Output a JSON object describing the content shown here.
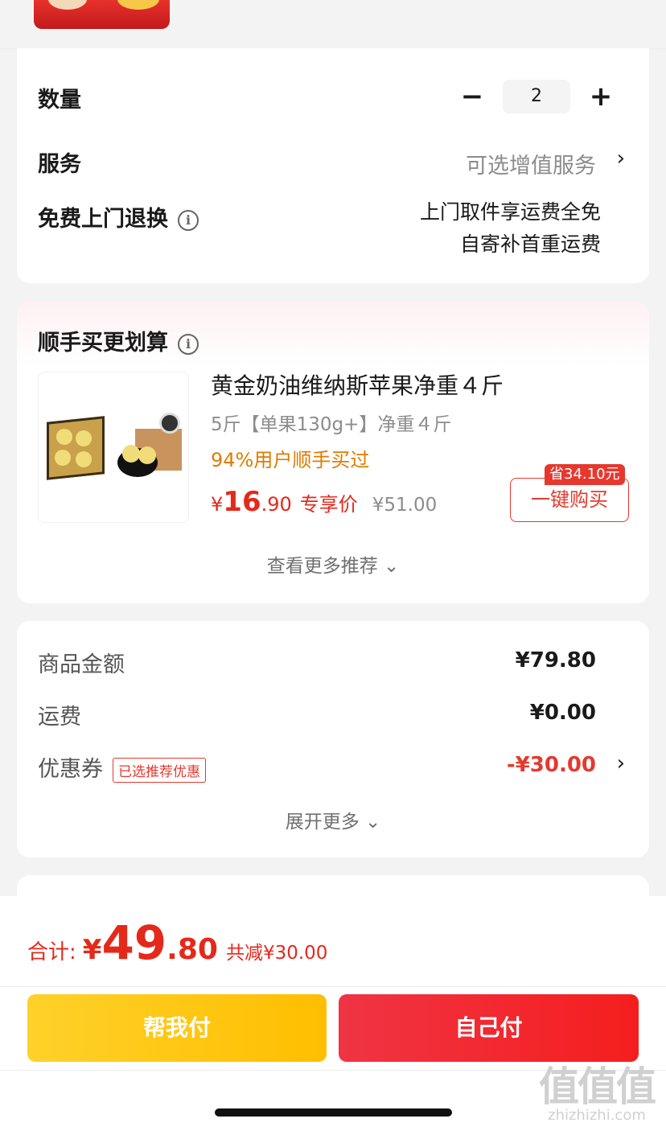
{
  "quantity": {
    "label": "数量",
    "minus": "−",
    "value": "2",
    "plus": "+"
  },
  "service": {
    "label": "服务",
    "value": "可选增值服务",
    "chevron": "›"
  },
  "return_policy": {
    "label": "免费上门退换",
    "info_icon": "i",
    "line1": "上门取件享运费全免",
    "line2": "自寄补首重运费"
  },
  "bundle": {
    "title": "顺手买更划算",
    "info_icon": "i",
    "product": {
      "title": "黄金奶油维纳斯苹果净重４斤",
      "spec": "5斤【单果130g+】净重４斤",
      "stat": "94%用户顺手买过",
      "price_yen": "¥",
      "price_int": "16",
      "price_dec": ".90",
      "price_tag": "专享价",
      "orig_price": "¥51.00",
      "save_badge": "省34.10元",
      "buy_button": "一键购买"
    },
    "more": "查看更多推荐 ⌄"
  },
  "amounts": {
    "goods_label": "商品金额",
    "goods_value": "¥79.80",
    "shipping_label": "运费",
    "shipping_value": "¥0.00",
    "coupon_label": "优惠券",
    "coupon_tag": "已选推荐优惠",
    "coupon_value": "-¥30.00",
    "chevron": "›",
    "expand": "展开更多 ⌄"
  },
  "footer": {
    "total_label": "合计:",
    "total_yen": "¥",
    "total_int": "49",
    "total_dec": ".80",
    "total_save": "共减¥30.00",
    "help_pay": "帮我付",
    "self_pay": "自己付"
  },
  "watermark": {
    "logo": "值值值",
    "url": "zhizhizhi.com"
  },
  "colors": {
    "accent_red": "#e4291b",
    "price_orange": "#e07b00",
    "help_pay_yellow": "#ffc60a",
    "self_pay_red": "#f02a2a"
  }
}
